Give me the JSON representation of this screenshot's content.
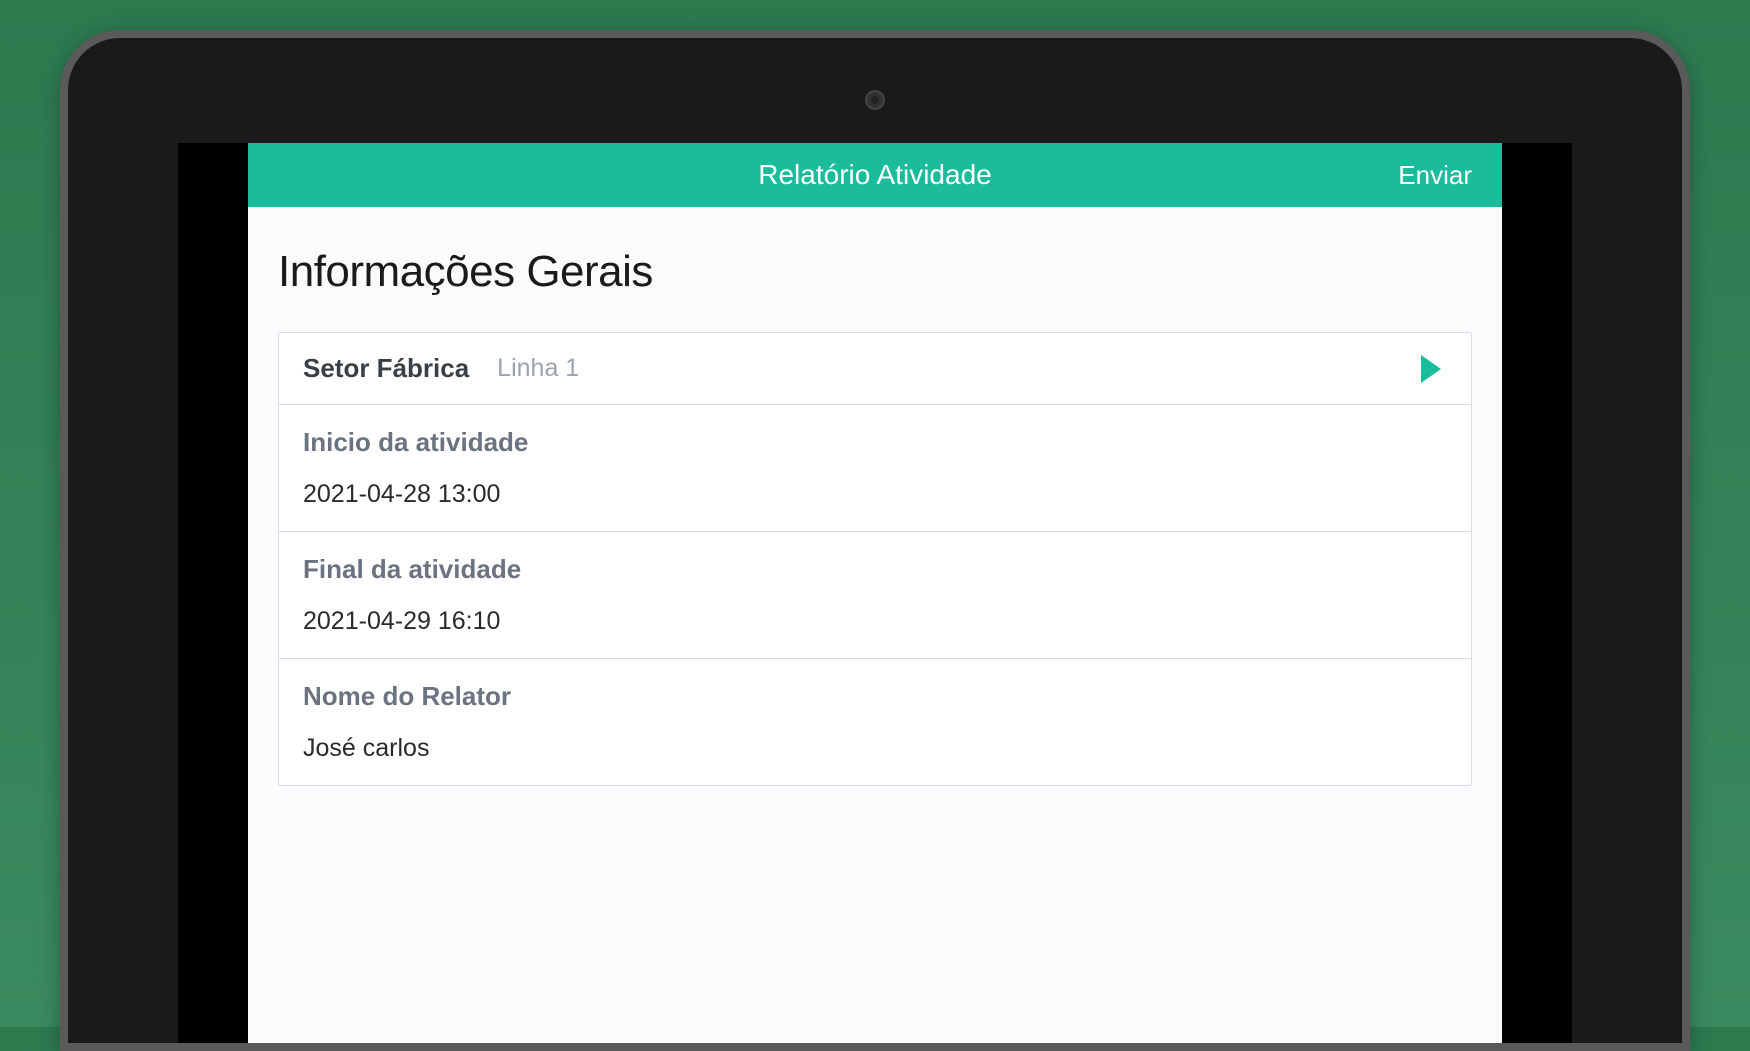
{
  "header": {
    "title": "Relatório Atividade",
    "action": "Enviar"
  },
  "section": {
    "title": "Informações Gerais"
  },
  "form": {
    "sector": {
      "label": "Setor Fábrica",
      "value": "Linha 1"
    },
    "start": {
      "label": "Inicio da atividade",
      "value": "2021-04-28 13:00"
    },
    "end": {
      "label": "Final da atividade",
      "value": "2021-04-29 16:10"
    },
    "reporter": {
      "label": "Nome do Relator",
      "value": "José carlos"
    }
  }
}
